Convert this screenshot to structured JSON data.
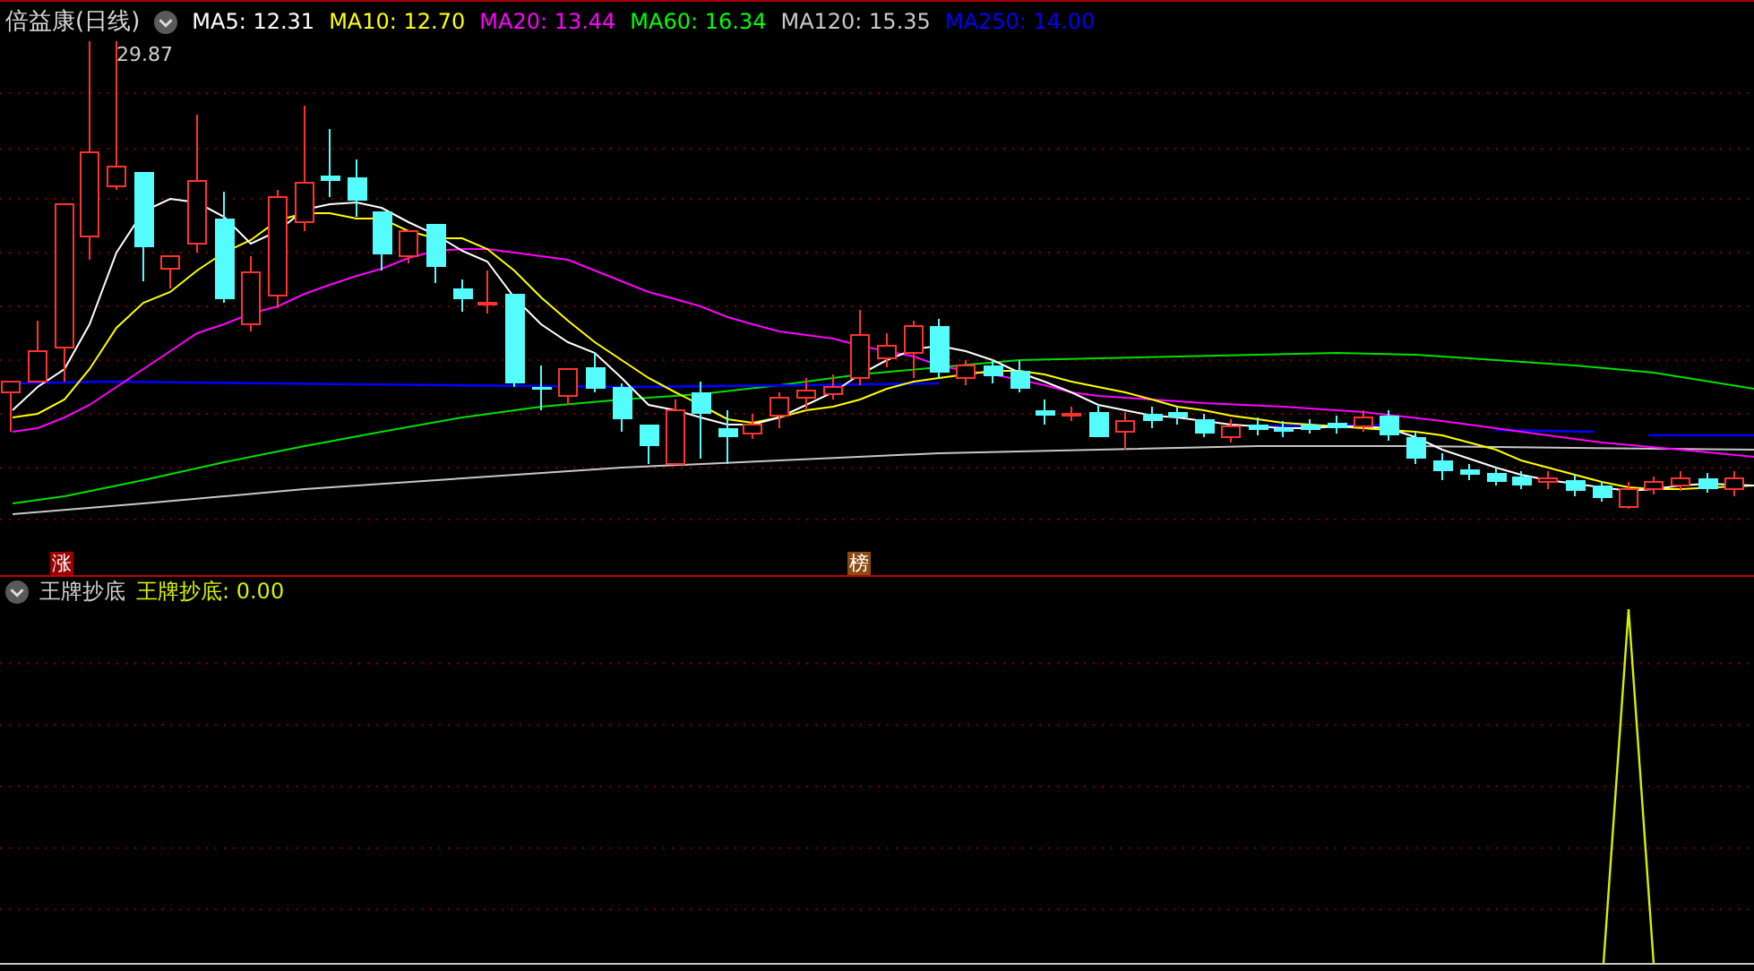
{
  "header": {
    "title": "倍益康(日线)",
    "indicators": [
      {
        "label": "MA5: 12.31",
        "color": "#ffffff"
      },
      {
        "label": "MA10: 12.70",
        "color": "#ffff00"
      },
      {
        "label": "MA20: 13.44",
        "color": "#ff00ff"
      },
      {
        "label": "MA60: 16.34",
        "color": "#00ff00"
      },
      {
        "label": "MA120: 15.35",
        "color": "#c8c8c8"
      },
      {
        "label": "MA250: 14.00",
        "color": "#0000ff"
      }
    ]
  },
  "main_chart": {
    "high_label": "29.87",
    "markers": [
      {
        "text": "涨",
        "color": "#990000"
      },
      {
        "text": "榜",
        "color": "#8b4a10"
      }
    ]
  },
  "indicator_panel": {
    "title": "王牌抄底",
    "readout": "王牌抄底: 0.00"
  }
}
